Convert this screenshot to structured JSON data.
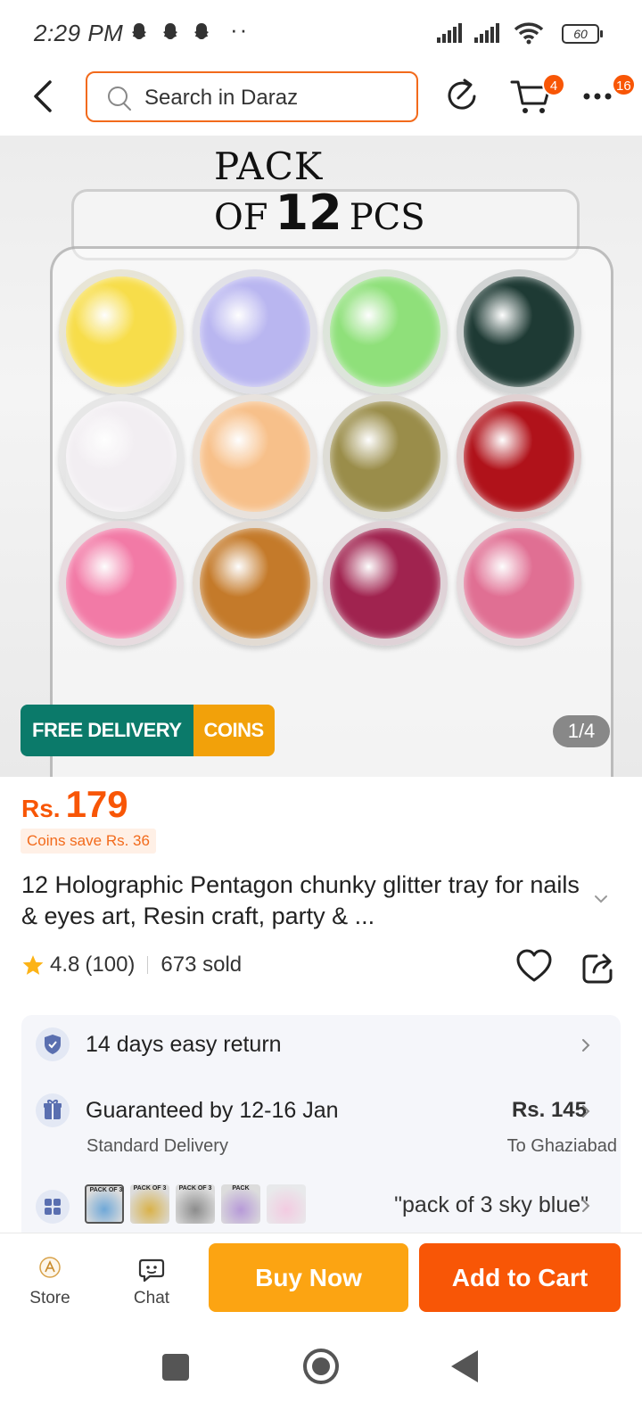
{
  "status_bar": {
    "time": "2:29 PM",
    "overflow_dots": "··",
    "battery": "60",
    "icons": [
      "snapchat-icon",
      "snapchat-icon",
      "snapchat-icon",
      "signal-icon",
      "signal-icon",
      "wifi-icon",
      "battery-icon"
    ]
  },
  "header": {
    "search_placeholder": "Search in Daraz",
    "cart_count": "4",
    "more_count": "16",
    "accent_color": "#f26a1b"
  },
  "gallery": {
    "pack_line1": "PACK",
    "pack_of": "OF",
    "pack_number": "12",
    "pack_pcs": "PCS",
    "free_delivery": "FREE DELIVERY",
    "coins": "COINS",
    "counter": "1/4",
    "jar_colors": [
      "#f7dd4a",
      "#b9b6f0",
      "#8fe07a",
      "#1e3a34",
      "#f2eef2",
      "#f7c08a",
      "#9a8d4a",
      "#b0121a",
      "#f27aa6",
      "#c47a2a",
      "#a0234f",
      "#e06f93"
    ]
  },
  "product": {
    "price_currency": "Rs.",
    "price_value": "179",
    "coins_save": "Coins save Rs. 36",
    "title": "12 Holographic Pentagon chunky glitter tray for nails & eyes art, Resin craft, party & ...",
    "rating": "4.8",
    "reviews": "(100)",
    "sold": "673 sold",
    "price_color": "#f85606"
  },
  "services": {
    "return_label": "14 days easy return",
    "delivery_label": "Guaranteed by 12-16 Jan",
    "delivery_type": "Standard Delivery",
    "delivery_price": "Rs. 145",
    "delivery_destination": "To Ghaziabad",
    "variant_label": "\"pack of 3 sky blue\"",
    "thumbnails": [
      {
        "label": "PACK OF 3",
        "color": "#6fa8d8"
      },
      {
        "label": "PACK OF 3",
        "color": "#d9b24a"
      },
      {
        "label": "PACK OF 3",
        "color": "#8c8c8c"
      },
      {
        "label": "PACK",
        "color": "#b79ad8"
      },
      {
        "label": "",
        "color": "#f0a0c8"
      }
    ]
  },
  "bottom_bar": {
    "store_label": "Store",
    "chat_label": "Chat",
    "buy_now": "Buy Now",
    "add_to_cart": "Add to Cart",
    "buy_color": "#fca412",
    "cart_color": "#f85606"
  }
}
